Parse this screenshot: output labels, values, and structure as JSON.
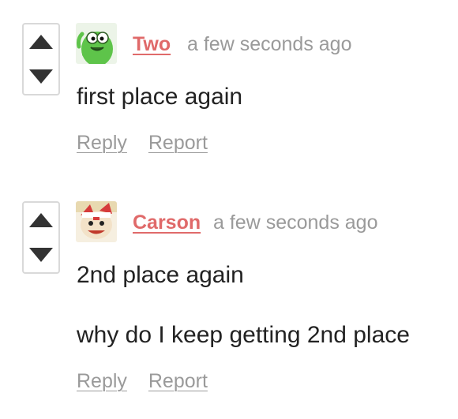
{
  "comments": [
    {
      "author": "Two",
      "timestamp": "a few seconds ago",
      "paragraphs": [
        "first place again"
      ],
      "reply_label": "Reply",
      "report_label": "Report"
    },
    {
      "author": "Carson",
      "timestamp": "a few seconds ago",
      "paragraphs": [
        "2nd place again",
        "why do I keep getting 2nd place"
      ],
      "reply_label": "Reply",
      "report_label": "Report"
    }
  ],
  "colors": {
    "author": "#e06a6a",
    "muted": "#9a9a9a",
    "text": "#222222",
    "vote_border": "#d9d9d9",
    "vote_arrow": "#333333"
  },
  "icons": {
    "upvote": "upvote-arrow-icon",
    "downvote": "downvote-arrow-icon"
  }
}
